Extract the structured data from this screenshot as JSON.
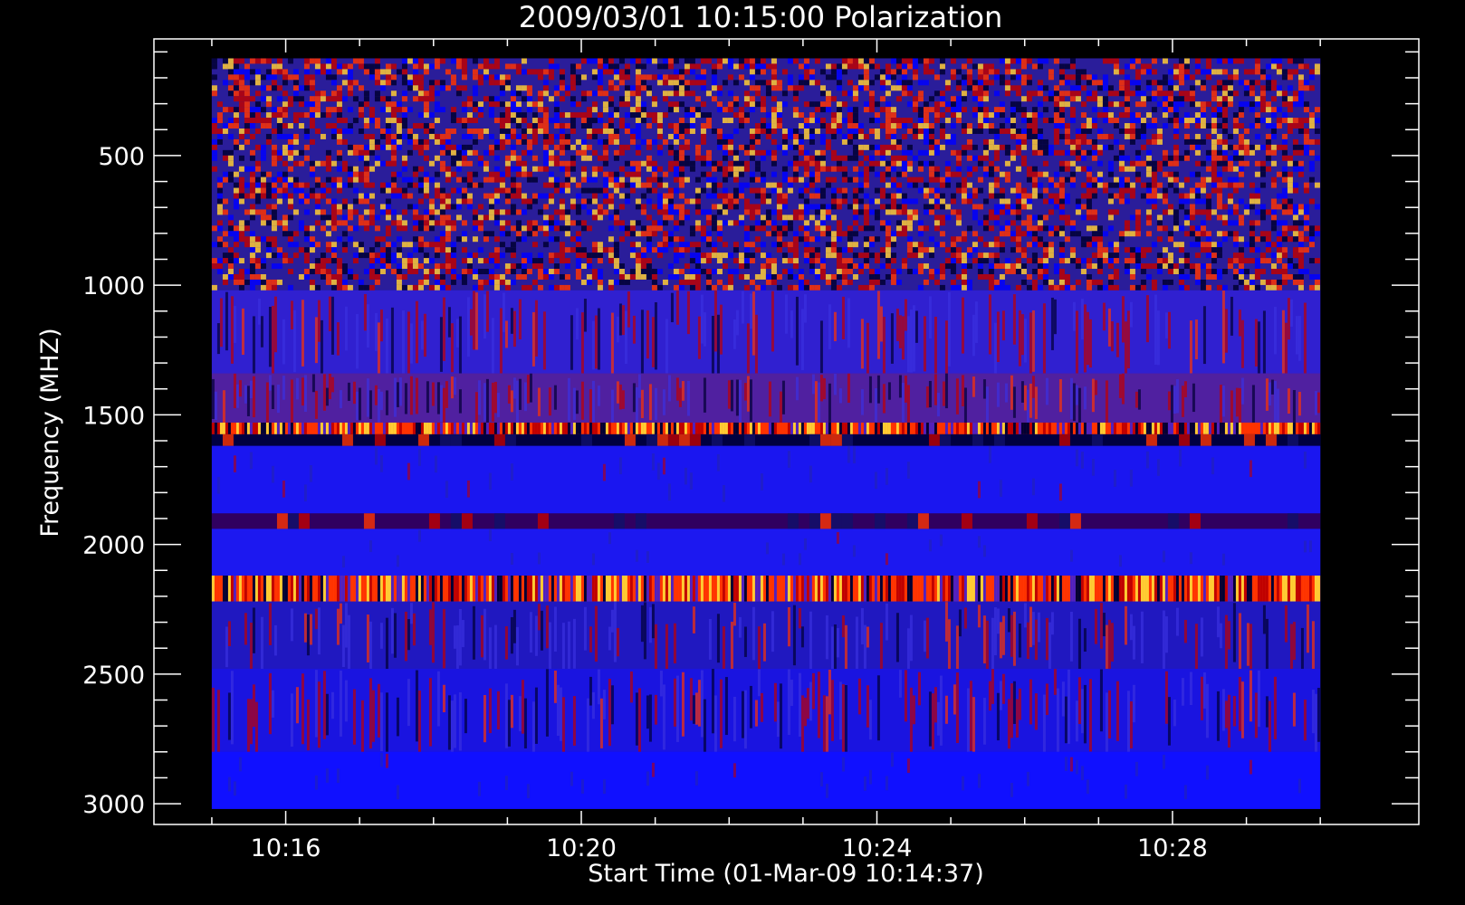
{
  "chart_data": {
    "type": "heatmap",
    "title": "2009/03/01  10:15:00 Polarization",
    "xlabel": "Start Time (01-Mar-09 10:14:37)",
    "ylabel": "Frequency (MHZ)",
    "x_range_minutes": [
      "10:15:00",
      "10:30:00"
    ],
    "xlim": [
      "10:14:13",
      "10:31:20"
    ],
    "ylim": [
      3080,
      50
    ],
    "y_data_range": [
      125,
      3020
    ],
    "x_ticks": [
      {
        "value": "10:16",
        "label": "10:16"
      },
      {
        "value": "10:20",
        "label": "10:20"
      },
      {
        "value": "10:24",
        "label": "10:24"
      },
      {
        "value": "10:28",
        "label": "10:28"
      }
    ],
    "x_minor_tick_minutes": [
      15,
      17,
      18,
      19,
      21,
      22,
      23,
      25,
      26,
      27,
      29,
      30
    ],
    "y_ticks": [
      {
        "value": 500,
        "label": "500"
      },
      {
        "value": 1000,
        "label": "1000"
      },
      {
        "value": 1500,
        "label": "1500"
      },
      {
        "value": 2000,
        "label": "2000"
      },
      {
        "value": 2500,
        "label": "2500"
      },
      {
        "value": 3000,
        "label": "3000"
      }
    ],
    "y_minor_step": 100,
    "colormap": [
      "#000033",
      "#0000ff",
      "#c00000",
      "#ff3300",
      "#ffcc33"
    ],
    "bands": [
      {
        "from": 125,
        "to": 1020,
        "texture": "noisy",
        "base": "#2a1d9a"
      },
      {
        "from": 1020,
        "to": 1340,
        "texture": "streaked",
        "base": "#3020d0"
      },
      {
        "from": 1340,
        "to": 1530,
        "texture": "streaked",
        "base": "#5020a0"
      },
      {
        "from": 1530,
        "to": 1575,
        "texture": "hot",
        "base": "#ff2a00"
      },
      {
        "from": 1575,
        "to": 1620,
        "texture": "dark",
        "base": "#000040"
      },
      {
        "from": 1620,
        "to": 1880,
        "texture": "smooth",
        "base": "#1a16f0"
      },
      {
        "from": 1880,
        "to": 1940,
        "texture": "dark",
        "base": "#300060"
      },
      {
        "from": 1940,
        "to": 2120,
        "texture": "smooth",
        "base": "#1c18f0"
      },
      {
        "from": 2120,
        "to": 2220,
        "texture": "hot",
        "base": "#ff8030"
      },
      {
        "from": 2220,
        "to": 2480,
        "texture": "streaked",
        "base": "#2018c0"
      },
      {
        "from": 2480,
        "to": 2800,
        "texture": "streaked",
        "base": "#1a14e0"
      },
      {
        "from": 2800,
        "to": 3020,
        "texture": "smooth",
        "base": "#1010ff"
      }
    ]
  }
}
